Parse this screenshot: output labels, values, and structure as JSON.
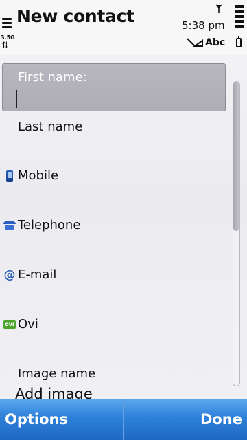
{
  "status": {
    "network_type": "3.5G",
    "time": "5:38 pm",
    "input_mode": "Abc"
  },
  "header": {
    "title": "New contact"
  },
  "form": {
    "fields": [
      {
        "label": "First name:",
        "icon": "none",
        "focused": true
      },
      {
        "label": "Last name",
        "icon": "none"
      },
      {
        "label": "Mobile",
        "icon": "mobile-phone-icon"
      },
      {
        "label": "Telephone",
        "icon": "telephone-icon"
      },
      {
        "label": "E-mail",
        "icon": "email-icon"
      },
      {
        "label": "Ovi",
        "icon": "ovi-icon",
        "icon_text": "ovi"
      },
      {
        "label": "Image name",
        "icon": "none"
      }
    ],
    "add_image_label": "Add image"
  },
  "scrollbar": {
    "position_fraction": 0.0
  },
  "softkeys": {
    "left_label": "Options",
    "right_label": "Done"
  },
  "colors": {
    "softkey_bar": "#2d80d8",
    "focused_field": "#b2b0b9",
    "icon_blue": "#2c5db8",
    "ovi_green": "#4ba32c"
  }
}
